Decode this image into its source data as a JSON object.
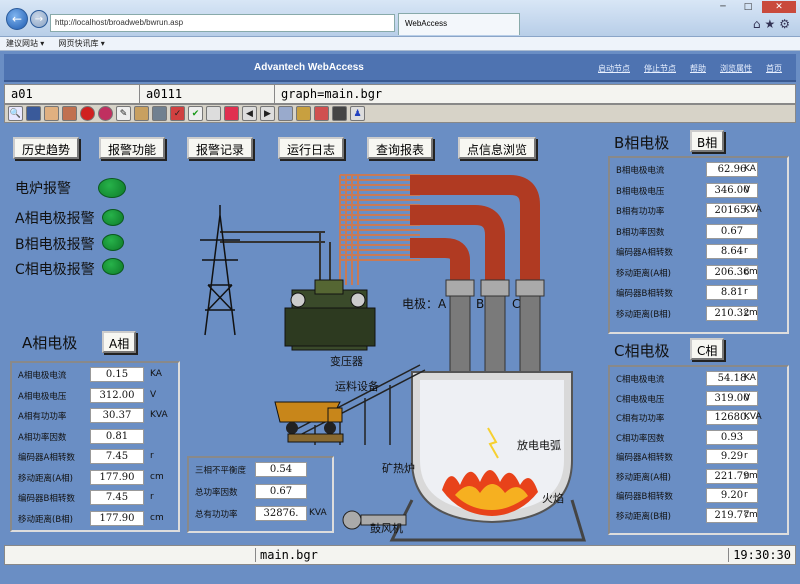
{
  "browser": {
    "address": "http://localhost/broadweb/bwrun.asp",
    "tab_title": "WebAccess",
    "fav_items": [
      "建议网站 ▾",
      "网页快讯库 ▾"
    ]
  },
  "header": {
    "title": "Advantech WebAccess",
    "links": [
      "启动节点",
      "停止节点",
      "帮助",
      "浏览属性",
      "首页"
    ]
  },
  "info": {
    "node": "a01",
    "project": "a0111",
    "graph": "graph=main.bgr"
  },
  "buttons": [
    "历史趋势",
    "报警功能",
    "报警记录",
    "运行日志",
    "查询报表",
    "点信息浏览"
  ],
  "alarms": [
    "电炉报警",
    "A相电极报警",
    "B相电极报警",
    "C相电极报警"
  ],
  "scene": {
    "transformer": "变压器",
    "conveyor": "运料设备",
    "electrode_label": "电极：A",
    "phaseB": "B",
    "phaseC": "C",
    "arc": "放电电弧",
    "furnace": "矿热炉",
    "flame": "火焰",
    "blower": "鼓风机"
  },
  "phaseA": {
    "title": "A相电极",
    "btn": "A相",
    "rows": [
      {
        "label": "A相电极电流",
        "value": "0.15",
        "unit": "KA"
      },
      {
        "label": "A相电极电压",
        "value": "312.00",
        "unit": "V"
      },
      {
        "label": "A相有功功率",
        "value": "30.37",
        "unit": "KVA"
      },
      {
        "label": "A相功率因数",
        "value": "0.81",
        "unit": ""
      },
      {
        "label": "编码器A相转数",
        "value": "7.45",
        "unit": "r"
      },
      {
        "label": "移动距离(A相)",
        "value": "177.90",
        "unit": "cm"
      },
      {
        "label": "编码器B相转数",
        "value": "7.45",
        "unit": "r"
      },
      {
        "label": "移动距离(B相)",
        "value": "177.90",
        "unit": "cm"
      }
    ]
  },
  "phaseB": {
    "title": "B相电极",
    "btn": "B相",
    "rows": [
      {
        "label": "B相电极电流",
        "value": "62.96",
        "unit": "KA"
      },
      {
        "label": "B相电极电压",
        "value": "346.00",
        "unit": "V"
      },
      {
        "label": "B相有功功率",
        "value": "20165.",
        "unit": "KVA"
      },
      {
        "label": "B相功率因数",
        "value": "0.67",
        "unit": ""
      },
      {
        "label": "编码器A相转数",
        "value": "8.64",
        "unit": "r"
      },
      {
        "label": "移动距离(A相)",
        "value": "206.36",
        "unit": "cm"
      },
      {
        "label": "编码器B相转数",
        "value": "8.81",
        "unit": "r"
      },
      {
        "label": "移动距离(B相)",
        "value": "210.32",
        "unit": "cm"
      }
    ]
  },
  "phaseC": {
    "title": "C相电极",
    "btn": "C相",
    "rows": [
      {
        "label": "C相电极电流",
        "value": "54.18",
        "unit": "KA"
      },
      {
        "label": "C相电极电压",
        "value": "319.00",
        "unit": "V"
      },
      {
        "label": "C相有功功率",
        "value": "12680.",
        "unit": "KVA"
      },
      {
        "label": "C相功率因数",
        "value": "0.93",
        "unit": ""
      },
      {
        "label": "编码器A相转数",
        "value": "9.29",
        "unit": "r"
      },
      {
        "label": "移动距离(A相)",
        "value": "221.79",
        "unit": "cm"
      },
      {
        "label": "编码器B相转数",
        "value": "9.20",
        "unit": "r"
      },
      {
        "label": "移动距离(B相)",
        "value": "219.77",
        "unit": "cm"
      }
    ]
  },
  "summary": {
    "rows": [
      {
        "label": "三相不平衡度",
        "value": "0.54",
        "unit": ""
      },
      {
        "label": "总功率因数",
        "value": "0.67",
        "unit": ""
      },
      {
        "label": "总有功功率",
        "value": "32876.",
        "unit": "KVA"
      }
    ]
  },
  "status": {
    "file": "main.bgr",
    "time": "19:30:30"
  },
  "colors": {
    "background": "#6a8ec4",
    "led_green": "#1ea53c",
    "electrode_red": "#b03a22"
  }
}
